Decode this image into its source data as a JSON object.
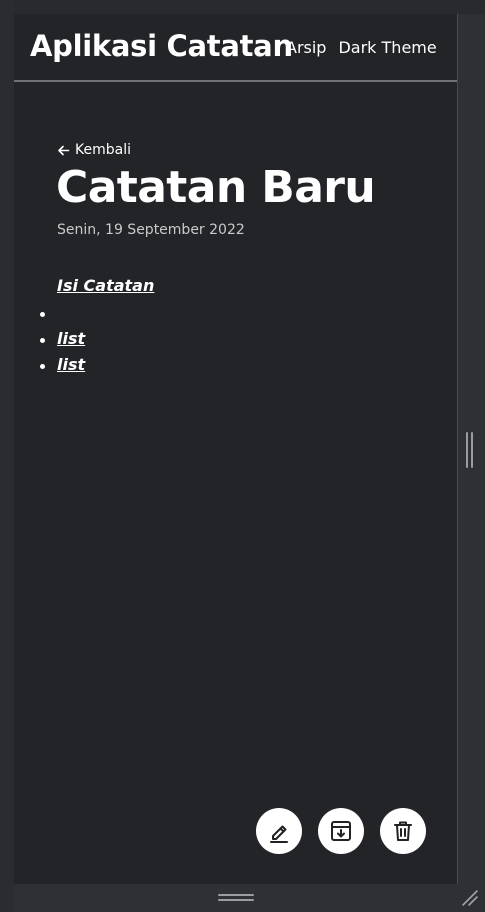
{
  "header": {
    "app_title": "Aplikasi Catatan",
    "nav": [
      {
        "label": "Arsip"
      },
      {
        "label": "Dark Theme"
      }
    ]
  },
  "note": {
    "back_label": "Kembali",
    "title": "Catatan Baru",
    "date": "Senin, 19 September 2022",
    "body_heading": "Isi Catatan",
    "body_list": [
      "",
      "list",
      "list"
    ]
  },
  "actions": [
    {
      "icon": "pencil-icon",
      "name": "edit-button"
    },
    {
      "icon": "archive-icon",
      "name": "archive-button"
    },
    {
      "icon": "trash-icon",
      "name": "delete-button"
    }
  ],
  "colors": {
    "background": "#232428",
    "text": "#ffffff",
    "muted_text": "#c9cacc",
    "button_bg": "#ffffff"
  }
}
